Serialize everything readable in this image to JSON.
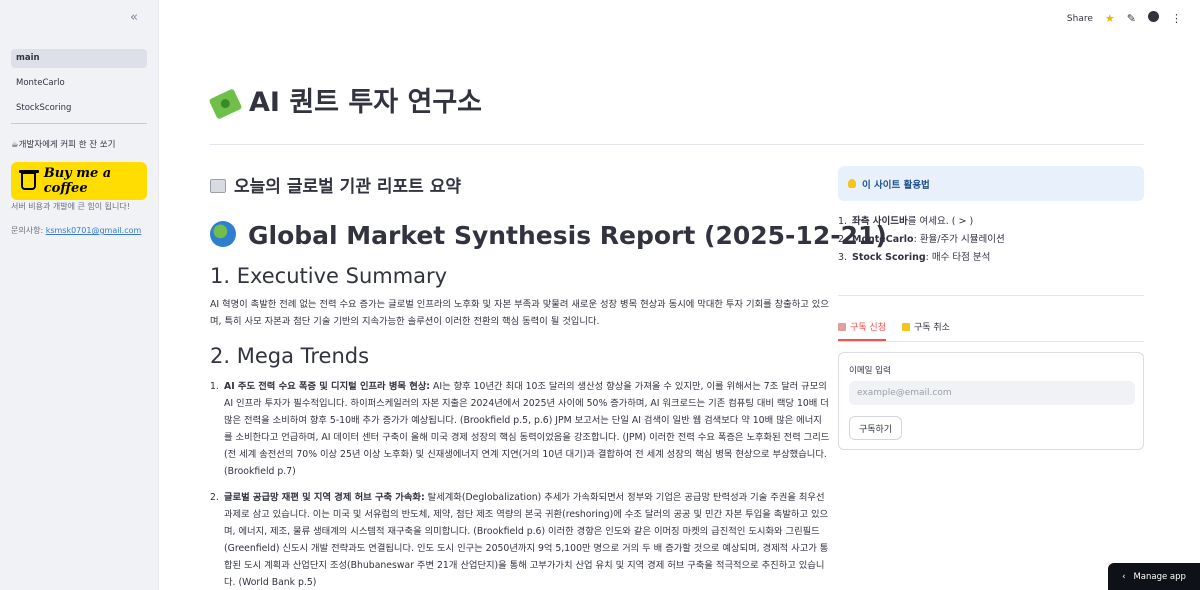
{
  "sidebar": {
    "collapse_icon": "«",
    "nav": [
      {
        "label": "main",
        "active": true
      },
      {
        "label": "MonteCarlo",
        "active": false
      },
      {
        "label": "StockScoring",
        "active": false
      }
    ],
    "coffee_title": "☕개발자에게 커피 한 잔 쏘기",
    "coffee_button": "Buy me a coffee",
    "server_note": "서버 비용과 개발에 큰 힘이 됩니다!",
    "contact_prefix": "문의사항: ",
    "contact_email": "ksmsk0701@gmail.com"
  },
  "topbar": {
    "share_label": "Share",
    "icons": [
      "star-icon",
      "edit-icon",
      "github-icon",
      "menu-icon"
    ]
  },
  "main": {
    "title": "AI 퀀트 투자 연구소",
    "subtitle": "오늘의 글로벌 기관 리포트 요약",
    "report_title": "Global Market Synthesis Report (2025-12-21)",
    "sections": [
      {
        "heading": "1. Executive Summary",
        "paragraph": "AI 혁명이 촉발한 전례 없는 전력 수요 증가는 글로벌 인프라의 노후화 및 자본 부족과 맞물려 새로운 성장 병목 현상과 동시에 막대한 투자 기회를 창출하고 있으며, 특히 사모 자본과 첨단 기술 기반의 지속가능한 솔루션이 이러한 전환의 핵심 동력이 될 것입니다."
      },
      {
        "heading": "2. Mega Trends",
        "items": [
          {
            "num": "1.",
            "bold": "AI 주도 전력 수요 폭증 및 디지털 인프라 병목 현상:",
            "text": " AI는 향후 10년간 최대 10조 달러의 생산성 향상을 가져올 수 있지만, 이를 위해서는 7조 달러 규모의 AI 인프라 투자가 필수적입니다. 하이퍼스케일러의 자본 지출은 2024년에서 2025년 사이에 50% 증가하며, AI 워크로드는 기존 컴퓨팅 대비 랙당 10배 더 많은 전력을 소비하여 향후 5-10배 추가 증가가 예상됩니다. (Brookfield p.5, p.6) JPM 보고서는 단일 AI 검색이 일반 웹 검색보다 약 10배 많은 에너지를 소비한다고 언급하며, AI 데이터 센터 구축이 올해 미국 경제 성장의 핵심 동력이었음을 강조합니다. (JPM) 이러한 전력 수요 폭증은 노후화된 전력 그리드(전 세계 송전선의 70% 이상 25년 이상 노후화) 및 신재생에너지 연계 지연(거의 10년 대기)과 결합하여 전 세계 성장의 핵심 병목 현상으로 부상했습니다. (Brookfield p.7)"
          },
          {
            "num": "2.",
            "bold": "글로벌 공급망 재편 및 지역 경제 허브 구축 가속화:",
            "text": " 탈세계화(Deglobalization) 추세가 가속화되면서 정부와 기업은 공급망 탄력성과 기술 주권을 최우선 과제로 삼고 있습니다. 이는 미국 및 서유럽의 반도체, 제약, 첨단 제조 역량의 본국 귀환(reshoring)에 수조 달러의 공공 및 민간 자본 투입을 촉발하고 있으며, 에너지, 제조, 물류 생태계의 시스템적 재구축을 의미합니다. (Brookfield p.6) 이러한 경향은 인도와 같은 이머징 마켓의 급진적인 도시화와 그린필드(Greenfield) 신도시 개발 전략과도 연결됩니다. 인도 도시 인구는 2050년까지 9억 5,100만 명으로 거의 두 배 증가할 것으로 예상되며, 경제적 사고가 통합된 도시 계획과 산업단지 조성(Bhubaneswar 주변 21개 산업단지)을 통해 고부가가치 산업 유치 및 지역 경제 허브 구축을 적극적으로 추진하고 있습니다. (World Bank p.5)"
          }
        ]
      }
    ]
  },
  "right": {
    "info_title": "이 사이트 활용법",
    "usage": [
      {
        "num": "1.",
        "bold": "좌측 사이드바",
        "text": "를 여세요. ( > )"
      },
      {
        "num": "2.",
        "bold": "MonteCarlo",
        "text": ": 환율/주가 시뮬레이션"
      },
      {
        "num": "3.",
        "bold": "Stock Scoring",
        "text": ": 매수 타점 분석"
      }
    ],
    "tabs": [
      {
        "label": "구독 신청",
        "active": true
      },
      {
        "label": "구독 취소",
        "active": false
      }
    ],
    "email_label": "이메일 입력",
    "email_placeholder": "example@email.com",
    "submit_label": "구독하기"
  },
  "manage_app": "Manage app",
  "colors": {
    "accent": "#ff4b4b",
    "coffee_yellow": "#ffdd00",
    "sidebar_bg": "#f0f2f6",
    "info_bg": "#e8f1fb"
  }
}
